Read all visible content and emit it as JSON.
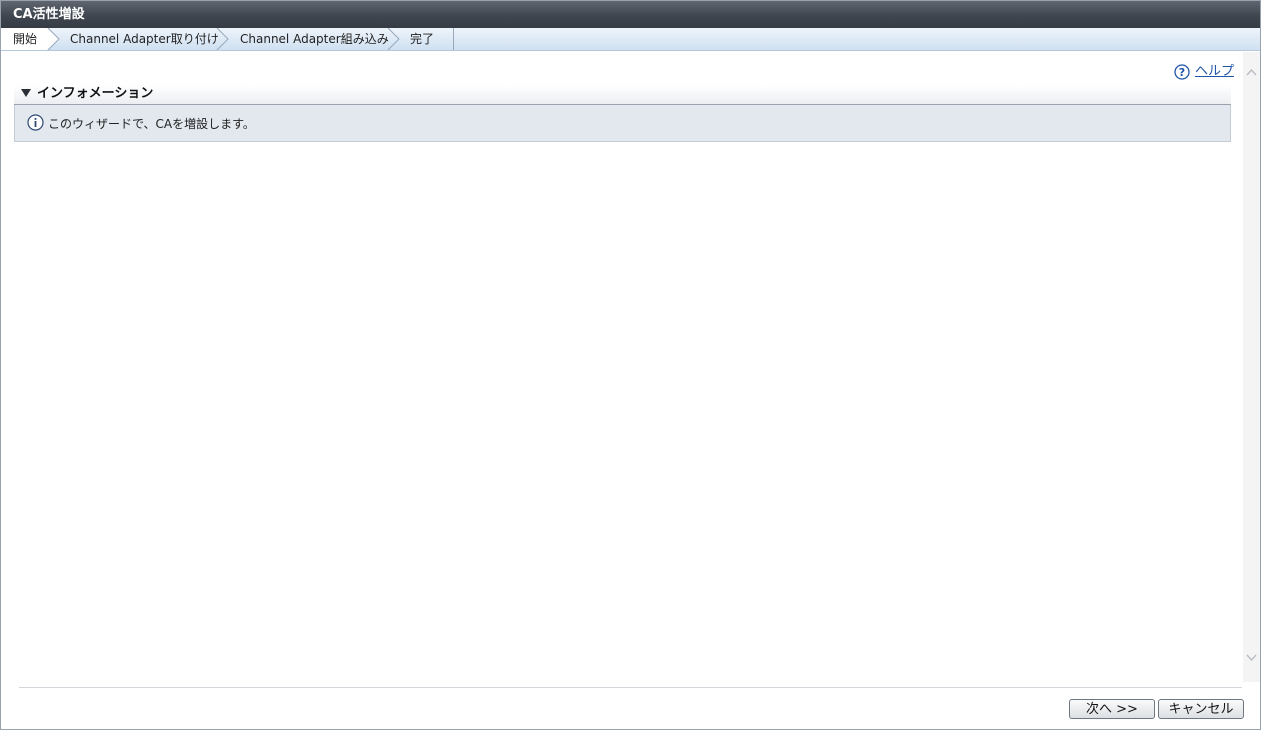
{
  "window": {
    "title": "CA活性増設"
  },
  "wizard_steps": [
    {
      "label": "開始",
      "active": true
    },
    {
      "label": "Channel Adapter取り付け",
      "active": false
    },
    {
      "label": "Channel Adapter組み込み",
      "active": false
    },
    {
      "label": "完了",
      "active": false
    }
  ],
  "help": {
    "label": "ヘルプ",
    "icon": "help-icon"
  },
  "information": {
    "title": "インフォメーション",
    "message": "このウィザードで、CAを増設します。",
    "icon": "info-icon"
  },
  "buttons": {
    "next": "次へ >>",
    "cancel": "キャンセル"
  },
  "colors": {
    "titlebar": "#3f4650",
    "steps_bg": "#cfe0f1",
    "info_bg": "#e3e8ef",
    "link": "#1f55a8"
  }
}
